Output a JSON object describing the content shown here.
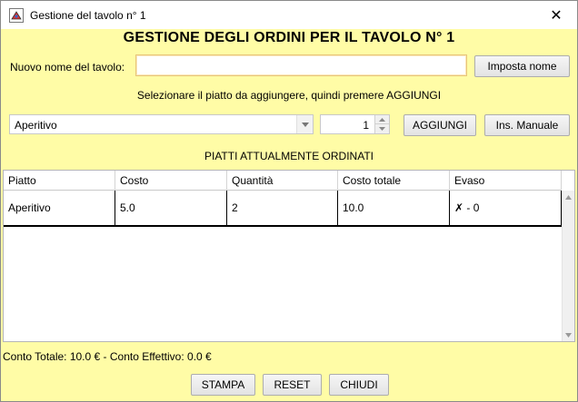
{
  "window": {
    "title": "Gestione del tavolo n° 1"
  },
  "heading": "GESTIONE DEGLI ORDINI PER IL TAVOLO N° 1",
  "rename": {
    "label": "Nuovo nome del tavolo:",
    "value": "",
    "button": "Imposta nome"
  },
  "instruction": "Selezionare il piatto da aggiungere, quindi premere AGGIUNGI",
  "selector": {
    "dish": "Aperitivo",
    "quantity": "1",
    "add_button": "AGGIUNGI",
    "manual_button": "Ins. Manuale"
  },
  "ordered_title": "PIATTI ATTUALMENTE ORDINATI",
  "table": {
    "columns": [
      "Piatto",
      "Costo",
      "Quantità",
      "Costo totale",
      "Evaso"
    ],
    "rows": [
      {
        "piatto": "Aperitivo",
        "costo": "5.0",
        "quantita": "2",
        "costo_totale": "10.0",
        "evaso": "✗ - 0"
      }
    ]
  },
  "totals": "Conto Totale: 10.0 € - Conto Effettivo: 0.0 €",
  "footer": {
    "print": "STAMPA",
    "reset": "RESET",
    "close": "CHIUDI"
  },
  "colors": {
    "background": "#fffca6",
    "field_border": "#e8c57a"
  },
  "icons": {
    "app": "java-app-icon",
    "close": "close-icon"
  }
}
